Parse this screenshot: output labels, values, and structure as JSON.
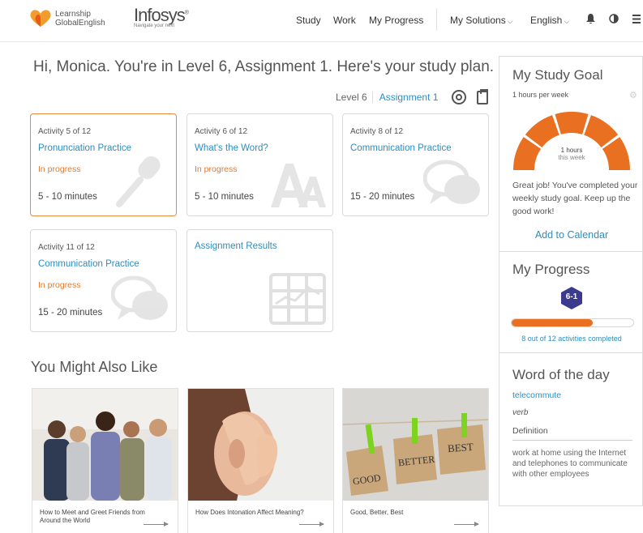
{
  "brand": {
    "logo_line1": "Learnship",
    "logo_line2": "GlobalEnglish",
    "partner_name": "Infosys",
    "partner_tagline": "Navigate your next"
  },
  "nav": {
    "study": "Study",
    "work": "Work",
    "my_progress": "My Progress",
    "my_solutions": "My Solutions",
    "language": "English"
  },
  "greeting": "Hi, Monica. You're in Level 6, Assignment 1. Here's your study plan.",
  "level_bar": {
    "level": "Level 6",
    "assignment": "Assignment 1"
  },
  "activities": [
    {
      "num": "Activity 5 of 12",
      "title": "Pronunciation Practice",
      "status": "In progress",
      "duration": "5 - 10 minutes",
      "icon": "microphone-icon"
    },
    {
      "num": "Activity 6 of 12",
      "title": "What's the Word?",
      "status": "In progress",
      "duration": "5 - 10 minutes",
      "icon": "letters-icon"
    },
    {
      "num": "Activity 8 of 12",
      "title": "Communication Practice",
      "status": "",
      "duration": "15 - 20 minutes",
      "icon": "chat-bubbles-icon"
    },
    {
      "num": "Activity 11 of 12",
      "title": "Communication Practice",
      "status": "In progress",
      "duration": "15 - 20 minutes",
      "icon": "chat-bubbles-icon"
    },
    {
      "num": "",
      "title": "Assignment Results",
      "status": "",
      "duration": "",
      "icon": "results-grid-icon"
    }
  ],
  "also_like": {
    "heading": "You Might Also Like",
    "items": [
      {
        "title": "How to Meet and Greet Friends from Around the World"
      },
      {
        "title": "How Does Intonation Affect Meaning?"
      },
      {
        "title": "Good, Better, Best"
      }
    ],
    "tag_words": [
      "GOOD",
      "BETTER",
      "BEST"
    ]
  },
  "study_goal": {
    "heading": "My Study Goal",
    "per_week": "1 hours per week",
    "gauge_value": "1 hours",
    "gauge_sub": "this week",
    "gauge_fraction": 1.0,
    "message": "Great job! You've completed your weekly study goal. Keep up the good work!",
    "calendar_link": "Add to Calendar"
  },
  "progress": {
    "heading": "My Progress",
    "badge": "6-1",
    "completed": 8,
    "total": 12,
    "label": "8 out of 12 activities completed"
  },
  "word_of_day": {
    "heading": "Word of the day",
    "word": "telecommute",
    "part_of_speech": "verb",
    "definition_label": "Definition",
    "definition": "work at home using the Internet and telephones to communicate with other employees"
  },
  "colors": {
    "accent": "#e96f21",
    "link": "#2d8dbd",
    "badge": "#3b3a8f"
  }
}
